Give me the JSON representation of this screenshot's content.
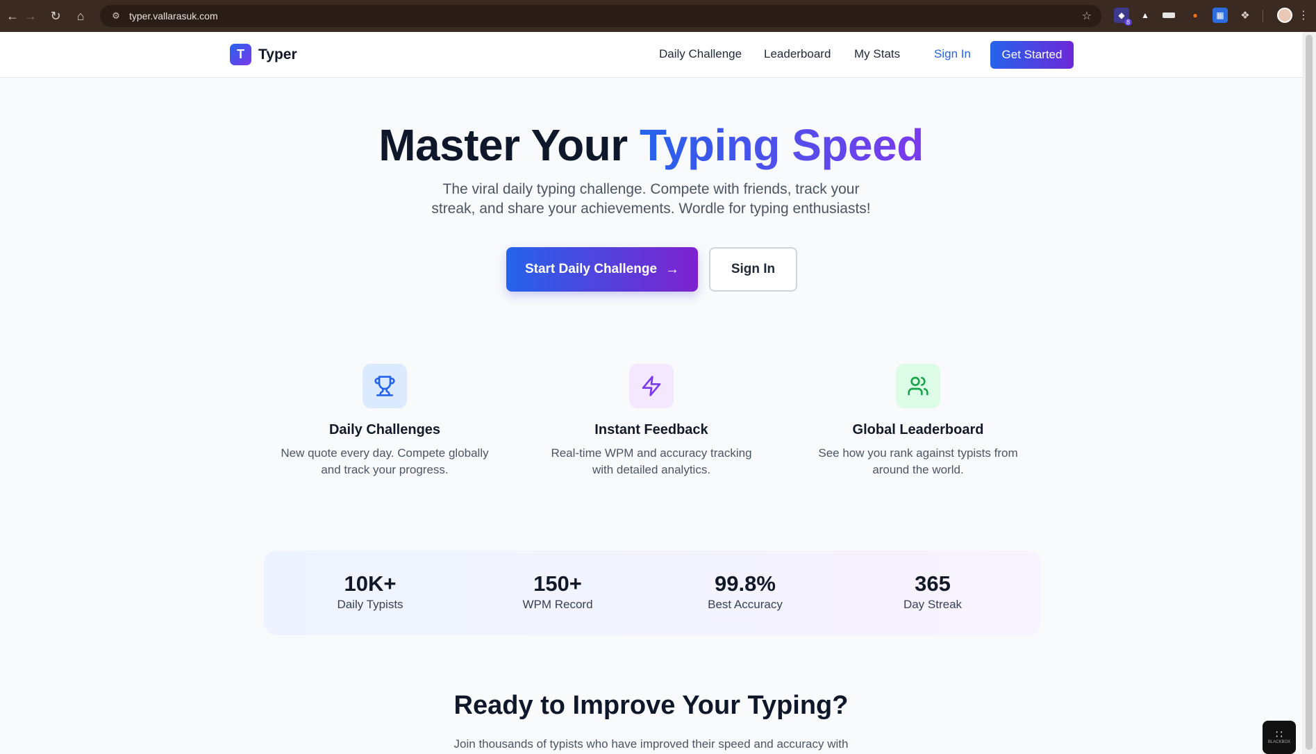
{
  "browser": {
    "url": "typer.vallarasuk.com",
    "extension_badge": "8"
  },
  "header": {
    "logo_letter": "T",
    "brand": "Typer",
    "nav": [
      "Daily Challenge",
      "Leaderboard",
      "My Stats"
    ],
    "sign_in": "Sign In",
    "get_started": "Get Started"
  },
  "hero": {
    "title_plain": "Master Your ",
    "title_highlight": "Typing Speed",
    "subtitle_line1": "The viral daily typing challenge. Compete with friends, track your",
    "subtitle_line2": "streak, and share your achievements. Wordle for typing enthusiasts!",
    "primary_cta": "Start Daily Challenge",
    "secondary_cta": "Sign In"
  },
  "features": [
    {
      "icon": "trophy-icon",
      "title": "Daily Challenges",
      "line1": "New quote every day. Compete globally",
      "line2": "and track your progress.",
      "color": "#2563eb",
      "bg": "#dbeafe"
    },
    {
      "icon": "lightning-icon",
      "title": "Instant Feedback",
      "line1": "Real-time WPM and accuracy tracking",
      "line2": "with detailed analytics.",
      "color": "#7c3aed",
      "bg": "#f3e8ff"
    },
    {
      "icon": "users-icon",
      "title": "Global Leaderboard",
      "line1": "See how you rank against typists from",
      "line2": "around the world.",
      "color": "#16a34a",
      "bg": "#dcfce7"
    }
  ],
  "stats": [
    {
      "value": "10K+",
      "label": "Daily Typists"
    },
    {
      "value": "150+",
      "label": "WPM Record"
    },
    {
      "value": "99.8%",
      "label": "Best Accuracy"
    },
    {
      "value": "365",
      "label": "Day Streak"
    }
  ],
  "cta": {
    "title": "Ready to Improve Your Typing?",
    "subtitle": "Join thousands of typists who have improved their speed and accuracy with"
  },
  "widget_label": "BLACKBOX"
}
